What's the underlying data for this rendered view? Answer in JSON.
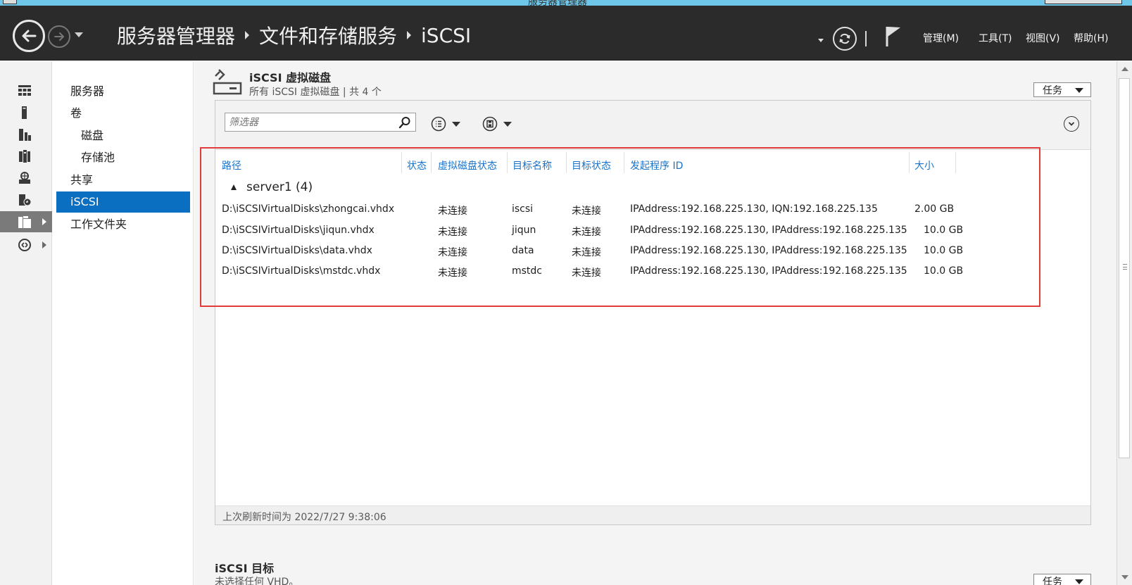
{
  "window": {
    "title": "服务器管理器"
  },
  "header": {
    "breadcrumb": [
      "服务器管理器",
      "文件和存储服务",
      "iSCSI"
    ],
    "menu": {
      "manage": "管理(M)",
      "tools": "工具(T)",
      "view": "视图(V)",
      "help": "帮助(H)"
    }
  },
  "iconstrip": {
    "icons": [
      "dashboard-icon",
      "local-server-icon",
      "all-servers-icon",
      "file-services-icon",
      "iis-icon",
      "storage-icon",
      "file-storage-icon",
      "network-icon"
    ]
  },
  "nav": {
    "items": [
      {
        "label": "服务器",
        "level": 0
      },
      {
        "label": "卷",
        "level": 0
      },
      {
        "label": "磁盘",
        "level": 1
      },
      {
        "label": "存储池",
        "level": 1
      },
      {
        "label": "共享",
        "level": 0
      },
      {
        "label": "iSCSI",
        "level": 0,
        "active": true
      },
      {
        "label": "工作文件夹",
        "level": 0
      }
    ]
  },
  "section": {
    "title": "iSCSI 虚拟磁盘",
    "subtitle": "所有 iSCSI 虚拟磁盘 | 共 4 个",
    "tasks_label": "任务",
    "filter_placeholder": "筛选器",
    "columns": [
      "路径",
      "状态",
      "虚拟磁盘状态",
      "目标名称",
      "目标状态",
      "发起程序 ID",
      "大小"
    ],
    "group": "server1 (4)",
    "rows": [
      [
        "D:\\iSCSIVirtualDisks\\zhongcai.vhdx",
        "",
        "未连接",
        "iscsi",
        "未连接",
        "IPAddress:192.168.225.130, IQN:192.168.225.135",
        "2.00 GB"
      ],
      [
        "D:\\iSCSIVirtualDisks\\jiqun.vhdx",
        "",
        "未连接",
        "jiqun",
        "未连接",
        "IPAddress:192.168.225.130, IPAddress:192.168.225.135",
        "10.0 GB"
      ],
      [
        "D:\\iSCSIVirtualDisks\\data.vhdx",
        "",
        "未连接",
        "data",
        "未连接",
        "IPAddress:192.168.225.130, IPAddress:192.168.225.135",
        "10.0 GB"
      ],
      [
        "D:\\iSCSIVirtualDisks\\mstdc.vhdx",
        "",
        "未连接",
        "mstdc",
        "未连接",
        "IPAddress:192.168.225.130, IPAddress:192.168.225.135",
        "10.0 GB"
      ]
    ],
    "last_refresh": "上次刷新时间为 2022/7/27 9:38:06"
  },
  "section2": {
    "title": "iSCSI 目标",
    "subtitle": "未选择任何 VHD。",
    "tasks_label": "任务"
  },
  "colors": {
    "accent": "#0b6fc1",
    "header_bg": "#2b2b2b",
    "link": "#1a73c9",
    "highlight_box": "#e03c3c"
  }
}
